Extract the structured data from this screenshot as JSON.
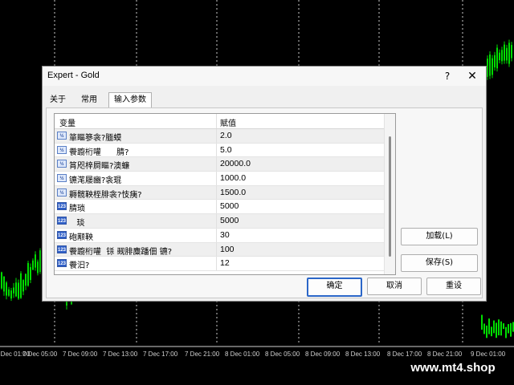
{
  "chart": {
    "time_labels": [
      "7 Dec 01:00",
      "7 Dec 05:00",
      "7 Dec 09:00",
      "7 Dec 13:00",
      "7 Dec 17:00",
      "7 Dec 21:00",
      "8 Dec 01:00",
      "8 Dec 05:00",
      "8 Dec 09:00",
      "8 Dec 13:00",
      "8 Dec 17:00",
      "8 Dec 21:00",
      "9 Dec 01:00"
    ],
    "candle_color": "#00dd00",
    "grid_color": "#ffffff"
  },
  "watermark": "www.mt4.shop",
  "dialog": {
    "title": "Expert - Gold",
    "help_glyph": "?",
    "close_glyph": "✕",
    "tabs": [
      "关于",
      "常用",
      "输入参数"
    ],
    "table": {
      "header_variable": "变量",
      "header_value": "赋值",
      "rows": [
        {
          "name": "箪瞘篸衾?腼蟆",
          "value": "2.0",
          "icon": "½"
        },
        {
          "name": "餋躕桁嚾      腈?",
          "value": "5.0",
          "icon": "½"
        },
        {
          "name": "筲咫梓屙瞘?澳蠊",
          "value": "20000.0",
          "icon": "½"
        },
        {
          "name": "镳滗屦豳?衾琨",
          "value": "1000.0",
          "icon": "½"
        },
        {
          "name": "耨髋鞅桎腓衾?忮痍?",
          "value": "1500.0",
          "icon": "½"
        },
        {
          "name": "腈琐",
          "value": "5000",
          "icon": "123"
        },
        {
          "name": "   琰",
          "value": "5000",
          "icon": "123"
        },
        {
          "name": "砲颟鞅",
          "value": "30",
          "icon": "123"
        },
        {
          "name": "餋躕桁嚾  铩 觋腓麋蹯佃 镳?",
          "value": "100",
          "icon": "123"
        },
        {
          "name": "餋汩?",
          "value": "12",
          "icon": "123"
        }
      ]
    },
    "buttons": {
      "load": "加载(L)",
      "save": "保存(S)",
      "ok": "确定",
      "cancel": "取消",
      "reset": "重设"
    }
  }
}
